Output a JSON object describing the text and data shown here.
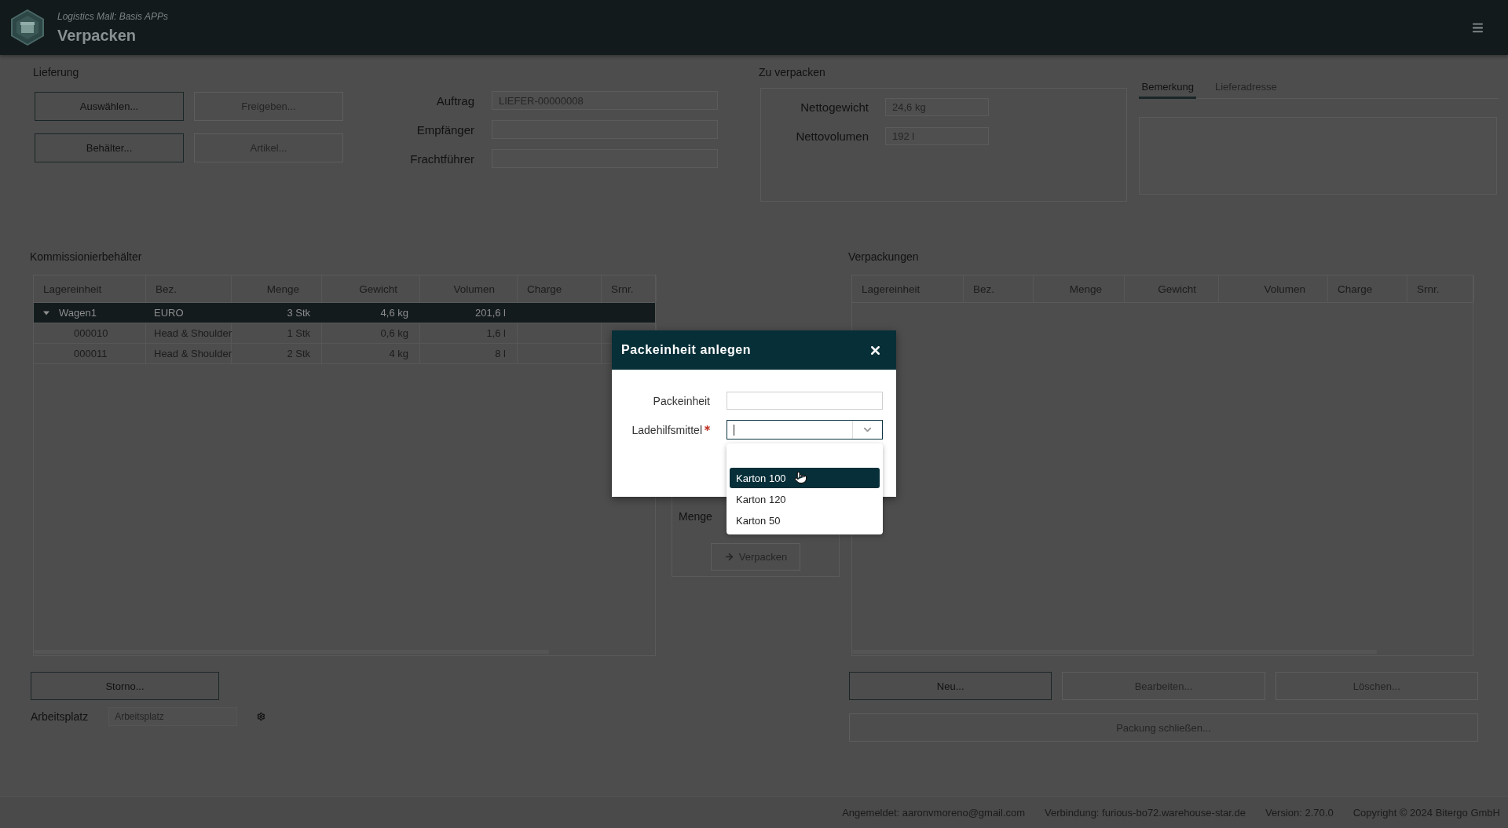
{
  "header": {
    "subtitle": "Logistics Mall: Basis APPs",
    "title": "Verpacken"
  },
  "delivery": {
    "title": "Lieferung",
    "buttons": [
      {
        "label": "Auswählen...",
        "disabled": false
      },
      {
        "label": "Freigeben...",
        "disabled": true
      },
      {
        "label": "Behälter...",
        "disabled": false
      },
      {
        "label": "Artikel...",
        "disabled": true
      }
    ],
    "fields": [
      {
        "label": "Auftrag",
        "value": "LIEFER-00000008"
      },
      {
        "label": "Empfänger"
      },
      {
        "label": "Frachtführer"
      }
    ]
  },
  "to_pack": {
    "title": "Zu verpacken",
    "fields": [
      {
        "label": "Nettogewicht",
        "value": "24,6 kg"
      },
      {
        "label": "Nettovolumen",
        "value": "192 l"
      }
    ]
  },
  "info_tabs": [
    {
      "label": "Bemerkung",
      "selected": true
    },
    {
      "label": "Lieferadresse",
      "selected": false
    }
  ],
  "picking_containers": {
    "title": "Kommissionierbehälter",
    "columns": [
      "Lagereinheit",
      "Bez.",
      "Menge",
      "Gewicht",
      "Volumen",
      "Charge",
      "Srnr."
    ],
    "rows": [
      {
        "cells": [
          "Wagen1",
          "EURO",
          "3 Stk",
          "4,6 kg",
          "201,6 l"
        ],
        "selected": true,
        "expanded": true,
        "children": [
          {
            "cells": [
              "000010",
              "Head & Shoulder",
              "1 Stk",
              "0,6 kg",
              "1,6 l"
            ],
            "selected": false
          },
          {
            "cells": [
              "000011",
              "Head & Shoulder",
              "2 Stk",
              "4 kg",
              "8 l"
            ],
            "selected": false
          }
        ]
      }
    ]
  },
  "transfer": {
    "quantity_label": "Menge",
    "button": "Verpacken"
  },
  "packages": {
    "title": "Verpackungen",
    "columns": [
      "Lagereinheit",
      "Bez.",
      "Menge",
      "Gewicht",
      "Volumen",
      "Charge",
      "Srnr."
    ]
  },
  "left_actions": {
    "buttons": [
      {
        "label": "Storno...",
        "disabled": false
      }
    ],
    "workplace": {
      "label": "Arbeitsplatz",
      "placeholder": "Arbeitsplatz"
    }
  },
  "right_actions": {
    "buttons": [
      {
        "label": "Neu...",
        "disabled": false
      },
      {
        "label": "Bearbeiten...",
        "disabled": true
      },
      {
        "label": "Löschen...",
        "disabled": true
      }
    ],
    "close_button": {
      "label": "Packung schließen...",
      "disabled": true
    }
  },
  "dialog": {
    "title": "Packeinheit anlegen",
    "fields": [
      {
        "kind": "text",
        "label": "Packeinheit",
        "required": false,
        "focused": false
      },
      {
        "kind": "select",
        "label": "Ladehilfsmittel",
        "required": true,
        "focused": true,
        "open": true,
        "options": [
          {
            "label": "Karton 100",
            "selected": true
          },
          {
            "label": "Karton 120",
            "selected": false
          },
          {
            "label": "Karton 50",
            "selected": false
          }
        ]
      }
    ]
  },
  "status_bar": [
    "Angemeldet: aaronvmoreno@gmail.com",
    "Verbindung: furious-bo72.warehouse-star.de",
    "Version: 2.70.0",
    "Copyright © 2024 Bitergo GmbH"
  ]
}
